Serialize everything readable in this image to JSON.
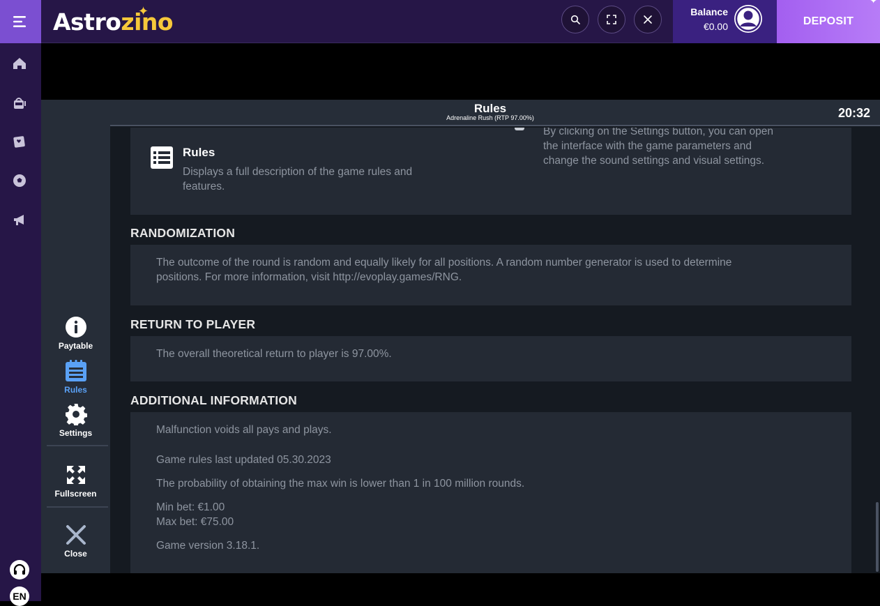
{
  "topbar": {
    "logo_text_a": "Astro",
    "logo_text_b": "zino",
    "balance_label": "Balance",
    "balance_value": "€0.00",
    "deposit_label": "DEPOSIT"
  },
  "icons": {
    "menu": "menu-icon",
    "search": "search-icon",
    "fullscreen": "fullscreen-icon",
    "close": "close-icon",
    "avatar": "user-avatar-icon",
    "nav": [
      "home-icon",
      "slot-machine-icon",
      "live-casino-icon",
      "sports-icon",
      "promotions-icon"
    ],
    "support": "headset-icon"
  },
  "lang": "EN",
  "game": {
    "header_title": "Rules",
    "header_subtitle": "Adrenaline Rush (RTP 97.00%)",
    "clock": "20:32",
    "sidebar": {
      "paytable": "Paytable",
      "rules": "Rules",
      "settings": "Settings",
      "fullscreen": "Fullscreen",
      "close": "Close"
    },
    "rules_card": {
      "title": "Rules",
      "desc_line1": "Displays a full description of the game rules and",
      "desc_line2": "features."
    },
    "settings_card": {
      "line1": "By clicking on the Settings button, you can open",
      "line2": "the interface with the game parameters and",
      "line3": "change the sound settings and visual settings."
    },
    "randomization": {
      "title": "RANDOMIZATION",
      "line1": "The outcome of the round is random and equally likely for all positions. A random number generator is used to determine",
      "line2": "positions. For more information, visit http://evoplay.games/RNG."
    },
    "rtp": {
      "title": "RETURN TO PLAYER",
      "text": "The overall theoretical return to player is 97.00%."
    },
    "additional": {
      "title": "ADDITIONAL INFORMATION",
      "malfunction": "Malfunction voids all pays and plays.",
      "updated": "Game rules last updated 05.30.2023",
      "probability": "The probability of obtaining the max win is lower than 1 in 100 million rounds.",
      "min_bet": "Min bet: €1.00",
      "max_bet": "Max bet: €75.00",
      "version": "Game version 3.18.1."
    }
  }
}
